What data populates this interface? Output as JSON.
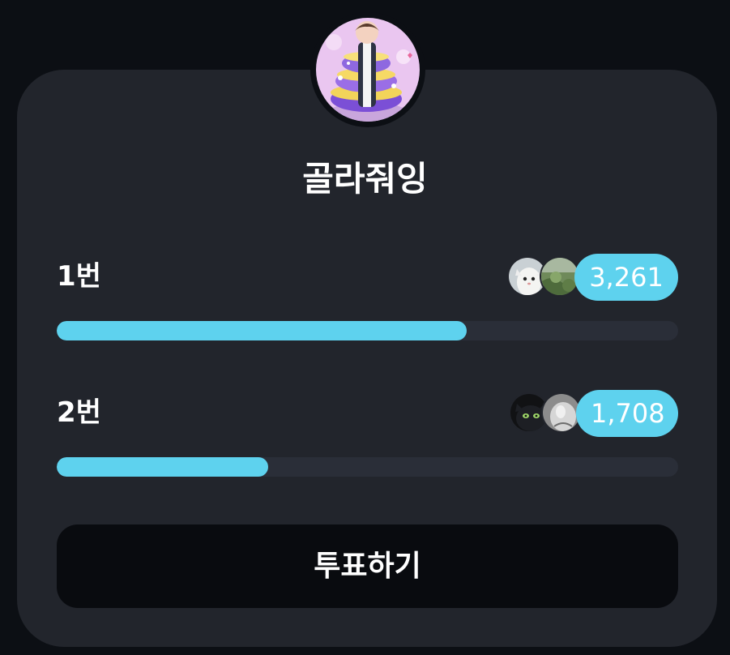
{
  "poll": {
    "title": "골라줘잉",
    "options": [
      {
        "label": "1번",
        "count": "3,261",
        "share": 0.66
      },
      {
        "label": "2번",
        "count": "1,708",
        "share": 0.34
      }
    ],
    "vote_button_label": "투표하기"
  },
  "colors": {
    "accent": "#5ed2ee",
    "card": "#22252c",
    "track": "#2a2e38",
    "button": "#090b0f",
    "background": "#0c0f14"
  }
}
